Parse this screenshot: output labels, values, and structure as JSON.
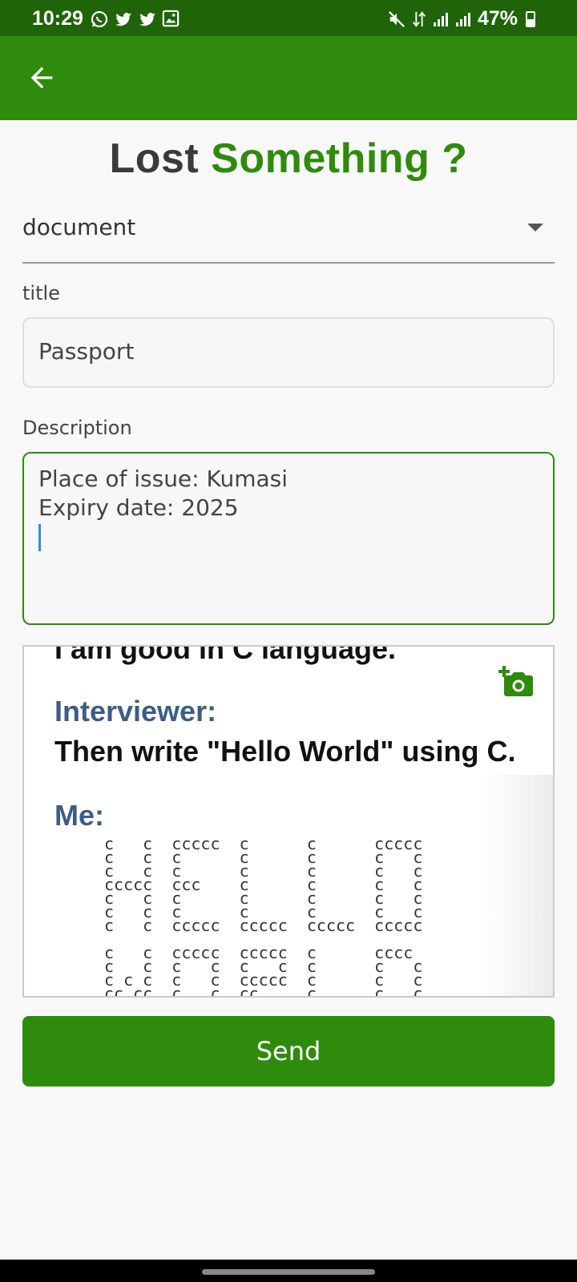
{
  "status_bar": {
    "time": "10:29",
    "left_icons": [
      "whatsapp-icon",
      "twitter-icon",
      "twitter-icon",
      "image-icon"
    ],
    "right_icons": [
      "mute-icon",
      "data-arrows-icon",
      "signal-icon",
      "signal-icon"
    ],
    "battery": "47%",
    "battery_level": 0.47
  },
  "app_bar": {
    "back_icon": "arrow-left-icon",
    "color": "#2e8b0c"
  },
  "heading": {
    "part1": "Lost",
    "part2": "Something ?"
  },
  "category": {
    "selected": "document"
  },
  "title_field": {
    "label": "title",
    "value": "Passport"
  },
  "description_field": {
    "label": "Description",
    "lines": [
      "Place of issue: Kumasi",
      "Expiry date: 2025"
    ]
  },
  "image_preview": {
    "line1": "I am good in C language.",
    "line2": "Interviewer:",
    "line3": "Then write \"Hello World\" using C.",
    "line4": "Me:",
    "add_photo_icon": "add-a-photo-icon"
  },
  "send_button": {
    "label": "Send"
  },
  "colors": {
    "accent": "#2e8b0c",
    "status_bar": "#1f6408",
    "focus_border": "#2e8b0c"
  }
}
